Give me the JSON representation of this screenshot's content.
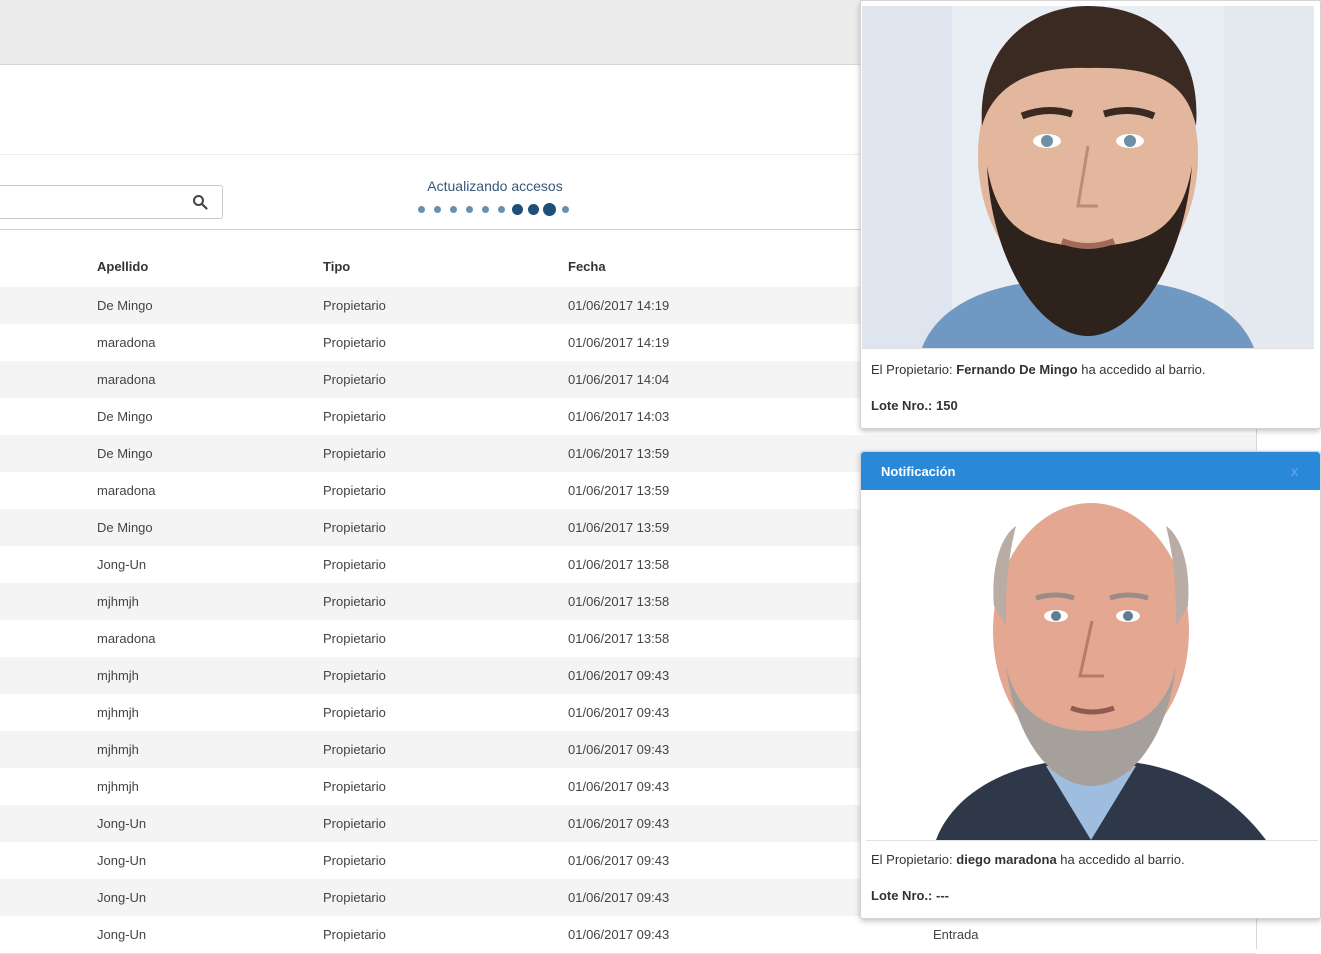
{
  "search": {
    "value": "",
    "placeholder": ""
  },
  "status": {
    "text": "Actualizando accesos",
    "dots_total": 10,
    "dots_active": [
      6,
      7,
      8
    ],
    "dot_color": "#6a8fb0",
    "dot_active_color": "#1e4f78"
  },
  "table": {
    "headers": {
      "apellido": "Apellido",
      "tipo": "Tipo",
      "fecha": "Fecha"
    },
    "rows": [
      {
        "apellido": "De Mingo",
        "tipo": "Propietario",
        "fecha": "01/06/2017 14:19",
        "accion": ""
      },
      {
        "apellido": "maradona",
        "tipo": "Propietario",
        "fecha": "01/06/2017 14:19",
        "accion": ""
      },
      {
        "apellido": "maradona",
        "tipo": "Propietario",
        "fecha": "01/06/2017 14:04",
        "accion": ""
      },
      {
        "apellido": "De Mingo",
        "tipo": "Propietario",
        "fecha": "01/06/2017 14:03",
        "accion": ""
      },
      {
        "apellido": "De Mingo",
        "tipo": "Propietario",
        "fecha": "01/06/2017 13:59",
        "accion": ""
      },
      {
        "apellido": "maradona",
        "tipo": "Propietario",
        "fecha": "01/06/2017 13:59",
        "accion": ""
      },
      {
        "apellido": "De Mingo",
        "tipo": "Propietario",
        "fecha": "01/06/2017 13:59",
        "accion": ""
      },
      {
        "apellido": "Jong-Un",
        "tipo": "Propietario",
        "fecha": "01/06/2017 13:58",
        "accion": ""
      },
      {
        "apellido": "mjhmjh",
        "tipo": "Propietario",
        "fecha": "01/06/2017 13:58",
        "accion": ""
      },
      {
        "apellido": "maradona",
        "tipo": "Propietario",
        "fecha": "01/06/2017 13:58",
        "accion": ""
      },
      {
        "apellido": "mjhmjh",
        "tipo": "Propietario",
        "fecha": "01/06/2017 09:43",
        "accion": ""
      },
      {
        "apellido": "mjhmjh",
        "tipo": "Propietario",
        "fecha": "01/06/2017 09:43",
        "accion": ""
      },
      {
        "apellido": "mjhmjh",
        "tipo": "Propietario",
        "fecha": "01/06/2017 09:43",
        "accion": ""
      },
      {
        "apellido": "mjhmjh",
        "tipo": "Propietario",
        "fecha": "01/06/2017 09:43",
        "accion": ""
      },
      {
        "apellido": "Jong-Un",
        "tipo": "Propietario",
        "fecha": "01/06/2017 09:43",
        "accion": ""
      },
      {
        "apellido": "Jong-Un",
        "tipo": "Propietario",
        "fecha": "01/06/2017 09:43",
        "accion": ""
      },
      {
        "apellido": "Jong-Un",
        "tipo": "Propietario",
        "fecha": "01/06/2017 09:43",
        "accion": ""
      },
      {
        "apellido": "Jong-Un",
        "tipo": "Propietario",
        "fecha": "01/06/2017 09:43",
        "accion": "Entrada"
      }
    ]
  },
  "notifications": [
    {
      "title": "",
      "photo_icon": "person-photo",
      "prefix": "El Propietario: ",
      "name": "Fernando De Mingo",
      "suffix": " ha accedido al barrio.",
      "lote_label": "Lote Nro.: ",
      "lote_value": "150"
    },
    {
      "title": "Notificación",
      "close_label": "x",
      "photo_icon": "person-photo",
      "prefix": "El Propietario: ",
      "name": "diego maradona",
      "suffix": " ha accedido al barrio.",
      "lote_label": "Lote Nro.: ",
      "lote_value": "---"
    }
  ],
  "colors": {
    "notification_header": "#2a88d8",
    "status_text": "#36587a"
  }
}
